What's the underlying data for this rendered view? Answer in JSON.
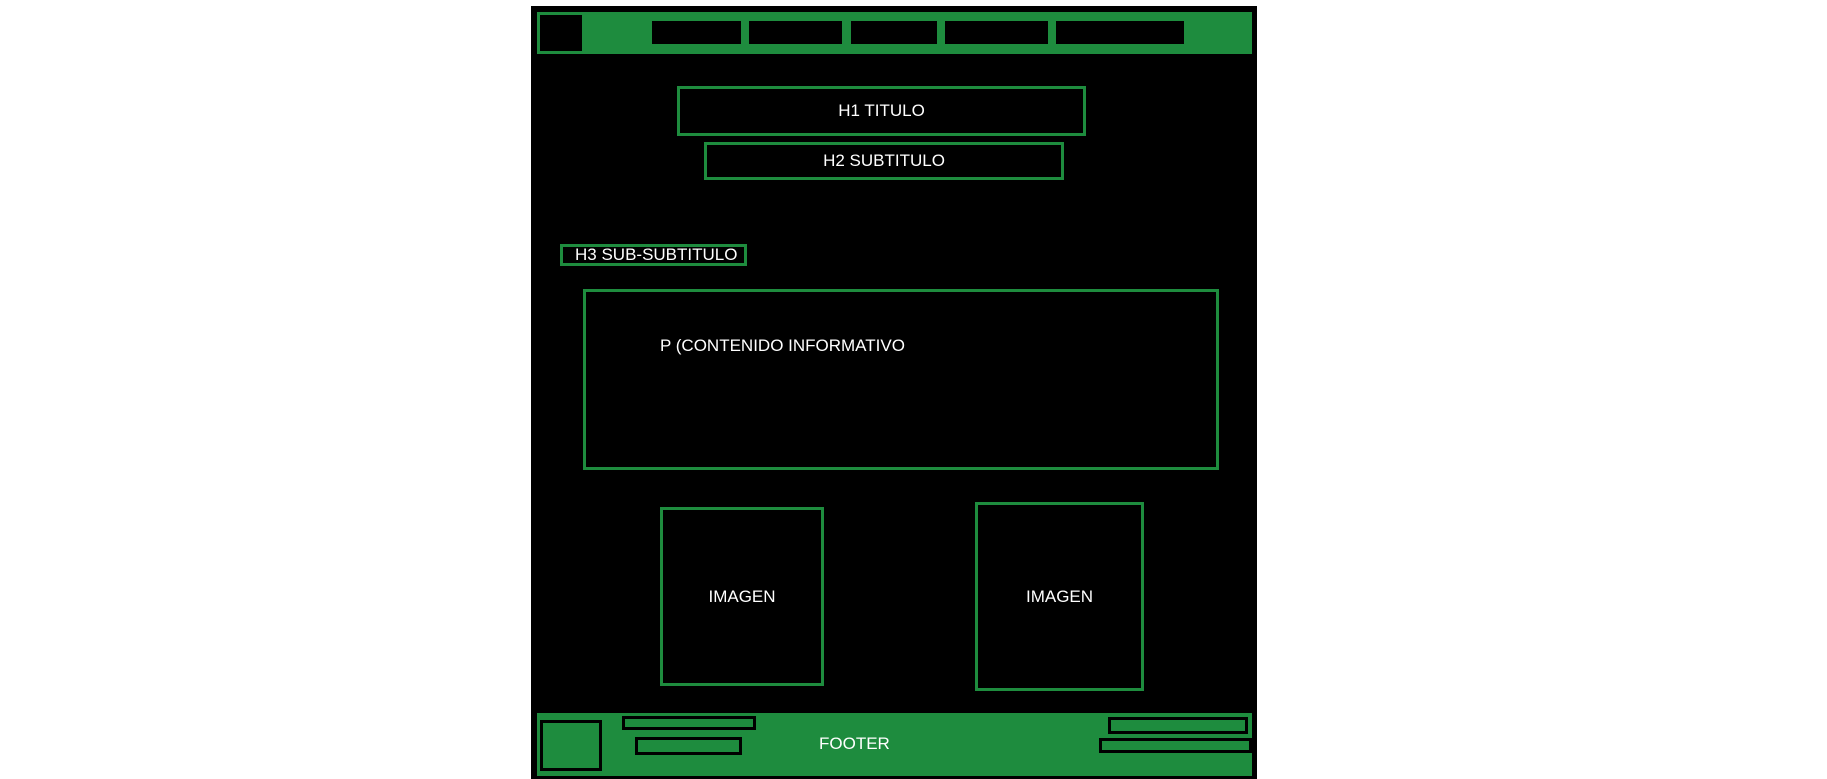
{
  "wireframe": {
    "colors": {
      "background": "#000000",
      "accent": "#1e8c3e",
      "text": "#ffffff"
    },
    "header": {
      "nav_item_count": 5
    },
    "h1": {
      "label": "H1 TITULO"
    },
    "h2": {
      "label": "H2 SUBTITULO"
    },
    "h3": {
      "label": "H3 SUB-SUBTITULO"
    },
    "paragraph": {
      "label": "P (CONTENIDO INFORMATIVO"
    },
    "images": [
      {
        "label": "IMAGEN"
      },
      {
        "label": "IMAGEN"
      }
    ],
    "footer": {
      "label": "FOOTER"
    }
  }
}
